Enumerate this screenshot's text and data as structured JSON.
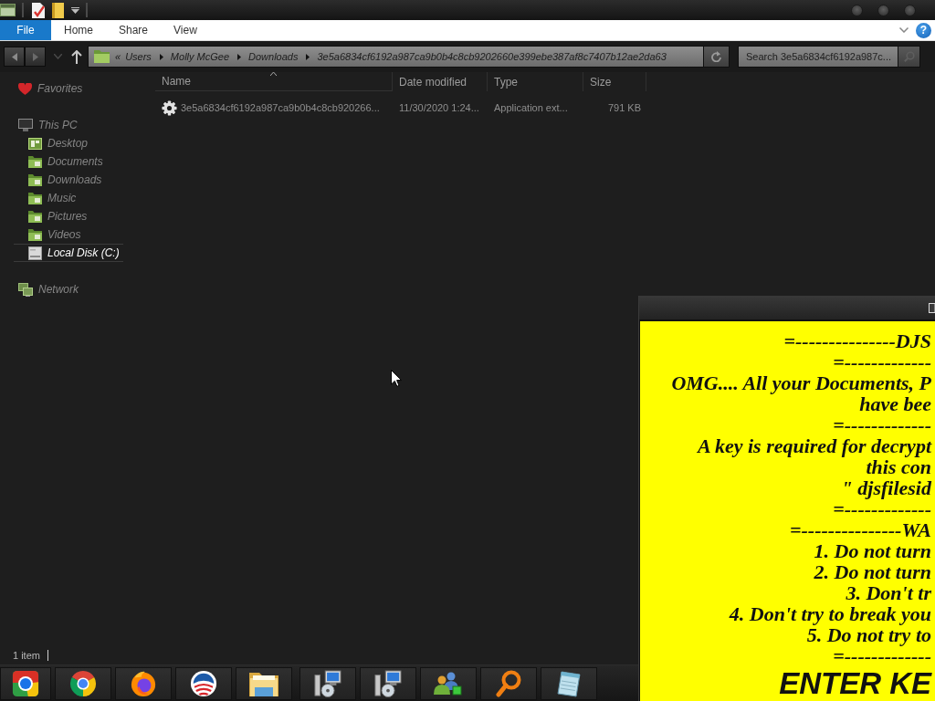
{
  "ribbon": {
    "tabs": [
      {
        "label": "File",
        "kind": "file"
      },
      {
        "label": "Home",
        "kind": "tab"
      },
      {
        "label": "Share",
        "kind": "tab"
      },
      {
        "label": "View",
        "kind": "tab"
      }
    ],
    "help": "?"
  },
  "address_bar": {
    "overflow": "«",
    "crumbs": [
      "Users",
      "Molly McGee",
      "Downloads",
      "3e5a6834cf6192a987ca9b0b4c8cb9202660e399ebe387af8c7407b12ae2da63"
    ]
  },
  "search": {
    "placeholder": "Search 3e5a6834cf6192a987c..."
  },
  "sidebar": {
    "items": [
      {
        "label": "Favorites",
        "kind": "favorites",
        "selected": false
      },
      {
        "label": "This PC",
        "kind": "computer",
        "selected": false,
        "children": [
          {
            "label": "Desktop",
            "kind": "desktop",
            "selected": false
          },
          {
            "label": "Documents",
            "kind": "folder",
            "selected": false
          },
          {
            "label": "Downloads",
            "kind": "folder",
            "selected": false
          },
          {
            "label": "Music",
            "kind": "folder",
            "selected": false
          },
          {
            "label": "Pictures",
            "kind": "folder",
            "selected": false
          },
          {
            "label": "Videos",
            "kind": "folder",
            "selected": false
          },
          {
            "label": "Local Disk (C:)",
            "kind": "drive",
            "selected": true
          }
        ]
      },
      {
        "label": "Network",
        "kind": "network",
        "selected": false
      }
    ]
  },
  "file_list": {
    "columns": [
      "Name",
      "Date modified",
      "Type",
      "Size"
    ],
    "rows": [
      {
        "name": "3e5a6834cf6192a987ca9b0b4c8cb920266...",
        "date_modified": "11/30/2020 1:24...",
        "type": "Application ext...",
        "size": "791 KB"
      }
    ]
  },
  "status_bar": {
    "item_count": "1 item"
  },
  "ransom_window": {
    "lines": [
      "=---------------DJS",
      "=-------------",
      "OMG.... All your Documents, P",
      "have bee",
      "=-------------",
      "A key is required for decrypt",
      "this con",
      "\" djsfilesid",
      "=-------------",
      "=---------------WA",
      "1. Do not turn",
      "2. Do not turn",
      "3. Don't tr",
      "4. Don't try to break you",
      "5. Do not try to",
      "=-------------"
    ],
    "heading": "ENTER KE"
  }
}
